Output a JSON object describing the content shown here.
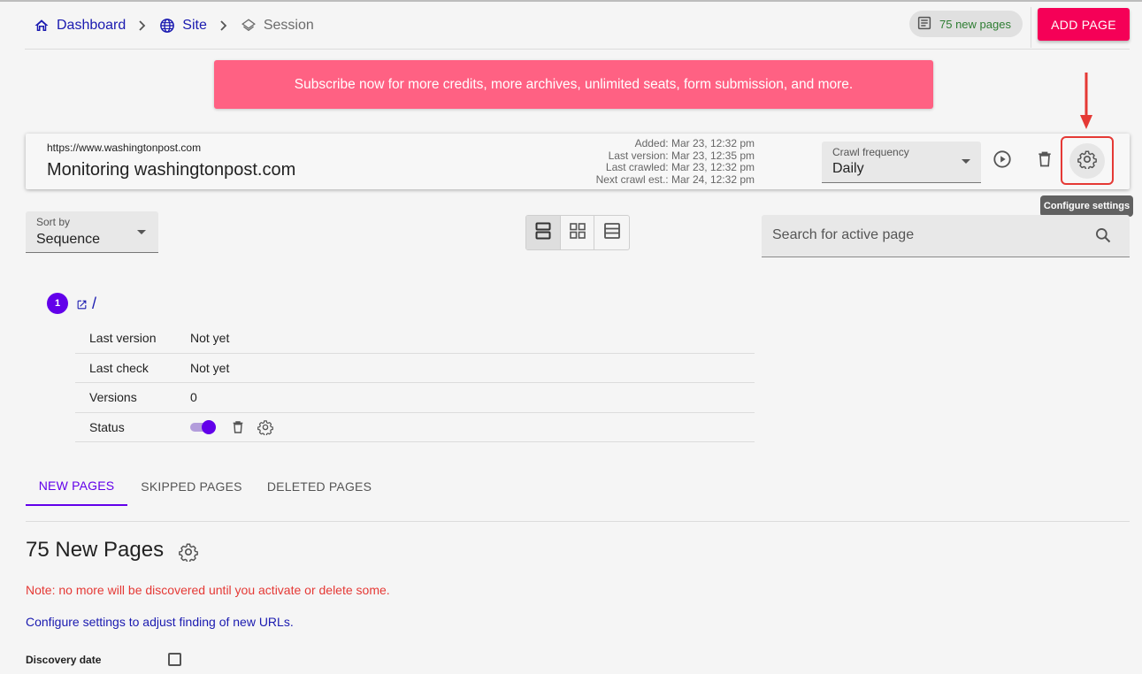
{
  "breadcrumb": {
    "items": [
      {
        "label": "Dashboard",
        "icon": "home-icon"
      },
      {
        "label": "Site",
        "icon": "globe-icon"
      },
      {
        "label": "Session",
        "icon": "layers-icon"
      }
    ]
  },
  "header": {
    "new_pages_label": "75 new pages",
    "add_page_label": "ADD PAGE"
  },
  "banner": {
    "text": "Subscribe now for more credits, more archives, unlimited seats, form submission, and more."
  },
  "monitor": {
    "url": "https://www.washingtonpost.com",
    "title": "Monitoring washingtonpost.com",
    "added": "Added: Mar 23, 12:32 pm",
    "last_version": "Last version: Mar 23, 12:35 pm",
    "last_crawled": "Last crawled: Mar 23, 12:32 pm",
    "next_crawl": "Next crawl est.: Mar 24, 12:32 pm",
    "crawl_frequency_label": "Crawl frequency",
    "crawl_frequency_value": "Daily",
    "tooltip": "Configure settings"
  },
  "controls": {
    "sort_label": "Sort by",
    "sort_value": "Sequence",
    "search_placeholder": "Search for active page"
  },
  "page_item": {
    "index": "1",
    "path": "/",
    "rows": [
      {
        "key": "Last version",
        "value": "Not yet"
      },
      {
        "key": "Last check",
        "value": "Not yet"
      },
      {
        "key": "Versions",
        "value": "0"
      },
      {
        "key": "Status",
        "value": ""
      }
    ],
    "status_enabled": true
  },
  "tabs": [
    {
      "label": "NEW PAGES",
      "active": true
    },
    {
      "label": "SKIPPED PAGES",
      "active": false
    },
    {
      "label": "DELETED PAGES",
      "active": false
    }
  ],
  "new_pages_section": {
    "title": "75 New Pages",
    "note": "Note: no more will be discovered until you activate or delete some.",
    "config_link": "Configure settings to adjust finding of new URLs.",
    "discovery_date_label": "Discovery date"
  },
  "colors": {
    "accent": "#f50057",
    "primary": "#6200ea",
    "banner": "#ff6183",
    "link": "#1a1ab0",
    "success": "#2e7d32",
    "error": "#e53935"
  }
}
